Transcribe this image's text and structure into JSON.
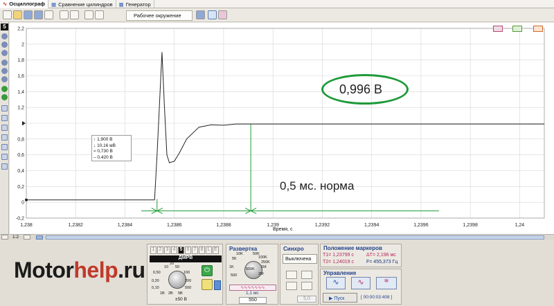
{
  "tabs": [
    {
      "label": "Осциллограф"
    },
    {
      "label": "Сравнение цилиндров"
    },
    {
      "label": "Генератор"
    }
  ],
  "toolbar": {
    "workspace_label": "Рабочее окружение"
  },
  "channel_badge": "5",
  "plot": {
    "y_ticks": [
      "2,2",
      "2",
      "1,8",
      "1,6",
      "1,4",
      "1,2",
      "1",
      "0,8",
      "0,6",
      "0,4",
      "0,2",
      "0",
      "-0,2"
    ],
    "x_ticks": [
      "1,238",
      "1,2382",
      "1,2384",
      "1,2386",
      "1,2388",
      "1,239",
      "1,2392",
      "1,2394",
      "1,2396",
      "1,2398",
      "1,24"
    ],
    "xlabel": "Время, с",
    "annotation_value": "0,996 В",
    "annotation_note": "0,5 мс. норма",
    "legend": [
      "1,900 В",
      "10,16 мВ",
      "0,730 В",
      "0,420 В"
    ],
    "scroll_zoom": "1:2",
    "colors": {
      "trace": "#222222",
      "marker": "#1f9a34",
      "circle": "#1e9a3a",
      "grid": "#d6d6d6"
    }
  },
  "chart_data": {
    "type": "line",
    "xlabel": "Время, с",
    "ylabel": "",
    "xlim": [
      1.238,
      1.2401
    ],
    "ylim": [
      -0.2,
      2.2
    ],
    "series": [
      {
        "x": [
          1.238,
          1.23852,
          1.23853,
          1.23855,
          1.23856,
          1.23857,
          1.23858,
          1.2386,
          1.23862,
          1.23865,
          1.2387,
          1.23875,
          1.2388,
          1.23885,
          1.2389,
          1.2394,
          1.2401
        ],
        "y": [
          0.03,
          0.03,
          0.6,
          1.9,
          1.2,
          0.6,
          0.5,
          0.52,
          0.62,
          0.8,
          0.95,
          0.98,
          0.975,
          0.99,
          0.99,
          0.99,
          0.99
        ]
      }
    ],
    "markers": {
      "x": [
        1.23853,
        1.23891
      ]
    },
    "annotations": [
      "0,996 В",
      "0,5 мс. норма"
    ],
    "grid": true
  },
  "channels": {
    "tabs": [
      "1",
      "2",
      "3",
      "4",
      "5",
      "6",
      "7",
      "8",
      "L",
      "E"
    ],
    "selected": "5",
    "sensor": "ДМРВ",
    "scale_labels": [
      "10",
      "20",
      "50",
      "0,50",
      "100",
      "0,20",
      "200",
      "0,10",
      "500",
      "1В",
      "2В",
      "5В"
    ],
    "scale": "±50 В"
  },
  "sweep": {
    "title": "Развертка",
    "labels": [
      "10K",
      "50K",
      "5K",
      "100K",
      "250K",
      "1K",
      "500K",
      "1M",
      "500",
      "2M"
    ],
    "time": "1,1 мс",
    "samples": "550"
  },
  "sync": {
    "title": "Синхро",
    "mode": "Выключена",
    "value": "5,0"
  },
  "markers": {
    "title": "Положение маркеров",
    "t1": "T1= 1,23799 с",
    "dt": "ΔT= 2,196 мс",
    "t2": "T2= 1,24019 с",
    "f": "F= 455,373 Гц"
  },
  "control": {
    "title": "Управление",
    "start": "Пуск",
    "timer": "[ 00:00:03:408 ]"
  },
  "logo": {
    "part1": "Motor",
    "part2": "help",
    "part3": ".ru"
  }
}
